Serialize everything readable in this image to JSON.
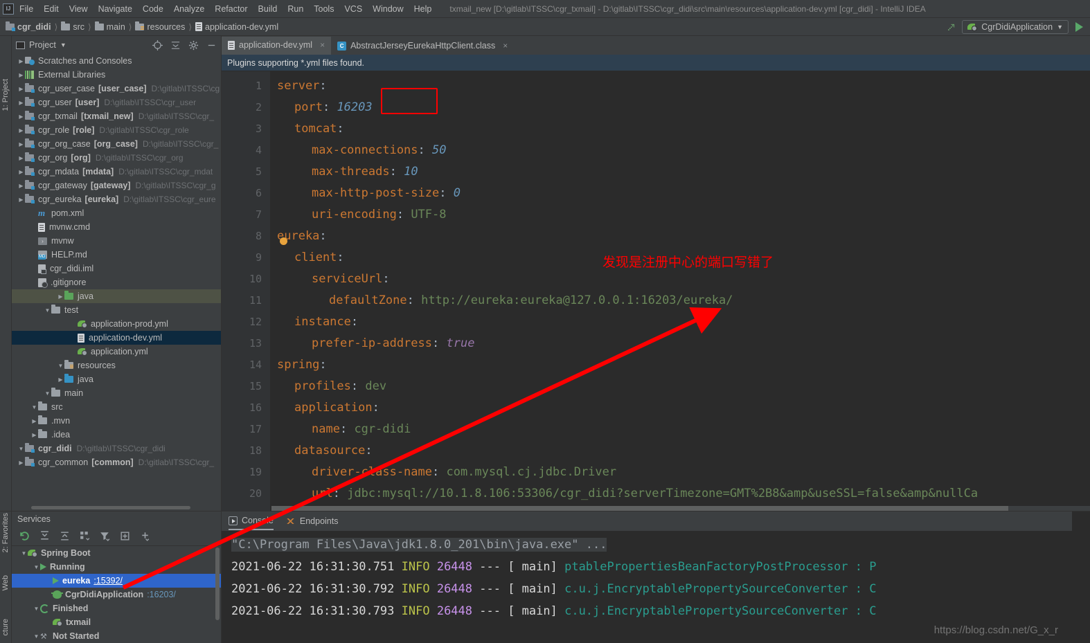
{
  "window": {
    "title": "txmail_new [D:\\gitlab\\ITSSC\\cgr_txmail] - D:\\gitlab\\ITSSC\\cgr_didi\\src\\main\\resources\\application-dev.yml [cgr_didi] - IntelliJ IDEA",
    "logo": "IJ"
  },
  "menu": [
    "File",
    "Edit",
    "View",
    "Navigate",
    "Code",
    "Analyze",
    "Refactor",
    "Build",
    "Run",
    "Tools",
    "VCS",
    "Window",
    "Help"
  ],
  "breadcrumb": [
    {
      "label": "cgr_didi",
      "icon": "module-icon",
      "bold": true
    },
    {
      "label": "src",
      "icon": "folder-icon",
      "bold": false
    },
    {
      "label": "main",
      "icon": "folder-icon",
      "bold": false
    },
    {
      "label": "resources",
      "icon": "resources-folder-icon",
      "bold": false
    },
    {
      "label": "application-dev.yml",
      "icon": "yaml-file-icon",
      "bold": false
    }
  ],
  "toolbar": {
    "run_config": "CgrDidiApplication",
    "run_button": "run-icon",
    "update_button": "update-running-application-icon"
  },
  "left_strip": {
    "project_label": "1: Project"
  },
  "bottom_strip": {
    "favorites_label": "2: Favorites",
    "web_label": "Web",
    "structure_label": "cture"
  },
  "project_panel": {
    "title": "Project",
    "tools": [
      "locate-icon",
      "collapse-all-icon",
      "settings-gear-icon",
      "hide-icon"
    ],
    "tree": [
      {
        "indent": 0,
        "twisty": "right",
        "icon": "module-icon",
        "label": "cgr_common",
        "module": "[common]",
        "path": "D:\\gitlab\\ITSSC\\cgr_",
        "sel": false
      },
      {
        "indent": 0,
        "twisty": "down",
        "icon": "module-icon",
        "label": "cgr_didi",
        "module": "",
        "path": "D:\\gitlab\\ITSSC\\cgr_didi",
        "sel": false,
        "bold": true
      },
      {
        "indent": 1,
        "twisty": "right",
        "icon": "folder-icon",
        "label": ".idea",
        "module": "",
        "path": "",
        "sel": false
      },
      {
        "indent": 1,
        "twisty": "right",
        "icon": "folder-icon",
        "label": ".mvn",
        "module": "",
        "path": "",
        "sel": false
      },
      {
        "indent": 1,
        "twisty": "down",
        "icon": "folder-icon",
        "label": "src",
        "module": "",
        "path": "",
        "sel": false
      },
      {
        "indent": 2,
        "twisty": "down",
        "icon": "folder-icon",
        "label": "main",
        "module": "",
        "path": "",
        "sel": false
      },
      {
        "indent": 3,
        "twisty": "right",
        "icon": "folder-blue-icon",
        "label": "java",
        "module": "",
        "path": "",
        "sel": false
      },
      {
        "indent": 3,
        "twisty": "down",
        "icon": "resources-folder-icon",
        "label": "resources",
        "module": "",
        "path": "",
        "sel": false
      },
      {
        "indent": 4,
        "twisty": "none",
        "icon": "spring-yaml-icon",
        "label": "application.yml",
        "module": "",
        "path": "",
        "sel": false
      },
      {
        "indent": 4,
        "twisty": "none",
        "icon": "yaml-file-icon",
        "label": "application-dev.yml",
        "module": "",
        "path": "",
        "sel": true
      },
      {
        "indent": 4,
        "twisty": "none",
        "icon": "spring-yaml-icon",
        "label": "application-prod.yml",
        "module": "",
        "path": "",
        "sel": false
      },
      {
        "indent": 2,
        "twisty": "down",
        "icon": "folder-icon",
        "label": "test",
        "module": "",
        "path": "",
        "sel": false
      },
      {
        "indent": 3,
        "twisty": "right",
        "icon": "folder-green-icon",
        "label": "java",
        "module": "",
        "path": "",
        "selg": true
      },
      {
        "indent": 1,
        "twisty": "none",
        "icon": "gitignore-icon",
        "label": ".gitignore",
        "module": "",
        "path": "",
        "sel": false
      },
      {
        "indent": 1,
        "twisty": "none",
        "icon": "iml-file-icon",
        "label": "cgr_didi.iml",
        "module": "",
        "path": "",
        "sel": false
      },
      {
        "indent": 1,
        "twisty": "none",
        "icon": "markdown-icon",
        "label": "HELP.md",
        "module": "",
        "path": "",
        "sel": false
      },
      {
        "indent": 1,
        "twisty": "none",
        "icon": "shell-script-icon",
        "label": "mvnw",
        "module": "",
        "path": "",
        "sel": false
      },
      {
        "indent": 1,
        "twisty": "none",
        "icon": "yaml-file-icon",
        "label": "mvnw.cmd",
        "module": "",
        "path": "",
        "sel": false
      },
      {
        "indent": 1,
        "twisty": "none",
        "icon": "maven-pom-icon",
        "label": "pom.xml",
        "module": "",
        "path": "",
        "sel": false
      },
      {
        "indent": 0,
        "twisty": "right",
        "icon": "module-icon",
        "label": "cgr_eureka",
        "module": "[eureka]",
        "path": "D:\\gitlab\\ITSSC\\cgr_eure",
        "sel": false
      },
      {
        "indent": 0,
        "twisty": "right",
        "icon": "module-icon",
        "label": "cgr_gateway",
        "module": "[gateway]",
        "path": "D:\\gitlab\\ITSSC\\cgr_g",
        "sel": false
      },
      {
        "indent": 0,
        "twisty": "right",
        "icon": "module-icon",
        "label": "cgr_mdata",
        "module": "[mdata]",
        "path": "D:\\gitlab\\ITSSC\\cgr_mdat",
        "sel": false
      },
      {
        "indent": 0,
        "twisty": "right",
        "icon": "module-icon",
        "label": "cgr_org",
        "module": "[org]",
        "path": "D:\\gitlab\\ITSSC\\cgr_org",
        "sel": false
      },
      {
        "indent": 0,
        "twisty": "right",
        "icon": "module-icon",
        "label": "cgr_org_case",
        "module": "[org_case]",
        "path": "D:\\gitlab\\ITSSC\\cgr_",
        "sel": false
      },
      {
        "indent": 0,
        "twisty": "right",
        "icon": "module-icon",
        "label": "cgr_role",
        "module": "[role]",
        "path": "D:\\gitlab\\ITSSC\\cgr_role",
        "sel": false
      },
      {
        "indent": 0,
        "twisty": "right",
        "icon": "module-icon",
        "label": "cgr_txmail",
        "module": "[txmail_new]",
        "path": "D:\\gitlab\\ITSSC\\cgr_",
        "sel": false
      },
      {
        "indent": 0,
        "twisty": "right",
        "icon": "module-icon",
        "label": "cgr_user",
        "module": "[user]",
        "path": "D:\\gitlab\\ITSSC\\cgr_user",
        "sel": false
      },
      {
        "indent": 0,
        "twisty": "right",
        "icon": "module-icon",
        "label": "cgr_user_case",
        "module": "[user_case]",
        "path": "D:\\gitlab\\ITSSC\\cg",
        "sel": false
      },
      {
        "indent": 0,
        "twisty": "right",
        "icon": "external-libraries-icon",
        "label": "External Libraries",
        "module": "",
        "path": "",
        "sel": false
      },
      {
        "indent": 0,
        "twisty": "right",
        "icon": "scratches-icon",
        "label": "Scratches and Consoles",
        "module": "",
        "path": "",
        "sel": false
      }
    ]
  },
  "editor": {
    "tabs": [
      {
        "label": "application-dev.yml",
        "icon": "yaml-file-icon",
        "active": true,
        "close": "×"
      },
      {
        "label": "AbstractJerseyEurekaHttpClient.class",
        "icon": "class-file-icon",
        "active": false,
        "close": "×"
      }
    ],
    "notification": "Plugins supporting *.yml files found.",
    "line_numbers": [
      "1",
      "2",
      "3",
      "4",
      "5",
      "6",
      "7",
      "8",
      "9",
      "10",
      "11",
      "12",
      "13",
      "14",
      "15",
      "16",
      "17",
      "18",
      "19",
      "20"
    ],
    "lines": [
      {
        "indent": 0,
        "key": "server",
        "sep": ":",
        "value": "",
        "vtype": ""
      },
      {
        "indent": 1,
        "key": "port",
        "sep": ":",
        "value": "16203",
        "vtype": "num"
      },
      {
        "indent": 1,
        "key": "tomcat",
        "sep": ":",
        "value": "",
        "vtype": ""
      },
      {
        "indent": 2,
        "key": "max-connections",
        "sep": ":",
        "value": "50",
        "vtype": "num"
      },
      {
        "indent": 2,
        "key": "max-threads",
        "sep": ":",
        "value": "10",
        "vtype": "num"
      },
      {
        "indent": 2,
        "key": "max-http-post-size",
        "sep": ":",
        "value": "0",
        "vtype": "num"
      },
      {
        "indent": 2,
        "key": "uri-encoding",
        "sep": ":",
        "value": "UTF-8",
        "vtype": "str"
      },
      {
        "indent": 0,
        "key": "eureka",
        "sep": ":",
        "value": "",
        "vtype": ""
      },
      {
        "indent": 1,
        "key": "client",
        "sep": ":",
        "value": "",
        "vtype": ""
      },
      {
        "indent": 2,
        "key": "serviceUrl",
        "sep": ":",
        "value": "",
        "vtype": ""
      },
      {
        "indent": 3,
        "key": "defaultZone",
        "sep": ":",
        "value": "http://eureka:eureka@127.0.0.1:16203/eureka/",
        "vtype": "str"
      },
      {
        "indent": 1,
        "key": "instance",
        "sep": ":",
        "value": "",
        "vtype": ""
      },
      {
        "indent": 2,
        "key": "prefer-ip-address",
        "sep": ":",
        "value": "true",
        "vtype": "bool"
      },
      {
        "indent": 0,
        "key": "spring",
        "sep": ":",
        "value": "",
        "vtype": ""
      },
      {
        "indent": 1,
        "key": "profiles",
        "sep": ":",
        "value": "dev",
        "vtype": "str"
      },
      {
        "indent": 1,
        "key": "application",
        "sep": ":",
        "value": "",
        "vtype": ""
      },
      {
        "indent": 2,
        "key": "name",
        "sep": ":",
        "value": "cgr-didi",
        "vtype": "str"
      },
      {
        "indent": 1,
        "key": "datasource",
        "sep": ":",
        "value": "",
        "vtype": ""
      },
      {
        "indent": 2,
        "key": "driver-class-name",
        "sep": ":",
        "value": "com.mysql.cj.jdbc.Driver",
        "vtype": "str"
      },
      {
        "indent": 2,
        "key": "url",
        "sep": ":",
        "value": "jdbc:mysql://10.1.8.106:53306/cgr_didi?serverTimezone=GMT%2B8&amp&useSSL=false&amp&nullCa",
        "vtype": "str"
      }
    ],
    "annotation": "发现是注册中心的端口写错了",
    "annotation_color": "#ff0000",
    "highlight_box_color": "#ff0000",
    "highlighted_value": "16203"
  },
  "services": {
    "title": "Services",
    "toolbar": [
      "rerun-icon",
      "expand-all-icon",
      "collapse-all-icon",
      "group-icon",
      "filter-icon",
      "add-tab-icon",
      "add-icon"
    ],
    "tree": [
      {
        "indent": 0,
        "twisty": "down",
        "icon": "spring-boot-icon",
        "label": "Spring Boot",
        "port": "",
        "sel": false
      },
      {
        "indent": 1,
        "twisty": "down",
        "icon": "run-icon",
        "label": "Running",
        "port": "",
        "sel": false
      },
      {
        "indent": 2,
        "twisty": "none",
        "icon": "run-icon",
        "label": "eureka",
        "port": ":15392/",
        "sel": true
      },
      {
        "indent": 2,
        "twisty": "none",
        "icon": "debug-bug-icon",
        "label": "CgrDidiApplication",
        "port": ":16203/",
        "sel": false
      },
      {
        "indent": 1,
        "twisty": "down",
        "icon": "rerun-icon",
        "label": "Finished",
        "port": "",
        "sel": false
      },
      {
        "indent": 2,
        "twisty": "none",
        "icon": "spring-boot-icon",
        "label": "txmail",
        "port": "",
        "sel": false
      },
      {
        "indent": 1,
        "twisty": "down",
        "icon": "wrench-icon",
        "label": "Not Started",
        "port": "",
        "sel": false
      }
    ]
  },
  "console": {
    "tabs": [
      {
        "label": "Console",
        "icon": "console-icon",
        "active": true
      },
      {
        "label": "Endpoints",
        "icon": "endpoints-icon",
        "active": false
      }
    ],
    "command": "\"C:\\Program Files\\Java\\jdk1.8.0_201\\bin\\java.exe\" ...",
    "log_rows": [
      {
        "ts": "2021-06-22 16:31:30.751",
        "level": "INFO",
        "pid": "26448",
        "dash": "---",
        "thread": "main]",
        "cls": "ptablePropertiesBeanFactoryPostProcessor",
        "colon": ": P"
      },
      {
        "ts": "2021-06-22 16:31:30.792",
        "level": "INFO",
        "pid": "26448",
        "dash": "---",
        "thread": "main]",
        "cls": "c.u.j.EncryptablePropertySourceConverter",
        "colon": ": C"
      },
      {
        "ts": "2021-06-22 16:31:30.793",
        "level": "INFO",
        "pid": "26448",
        "dash": "---",
        "thread": "main]",
        "cls": "c.u.j.EncryptablePropertySourceConverter",
        "colon": ": C"
      }
    ],
    "watermark": "https://blog.csdn.net/G_x_r"
  }
}
